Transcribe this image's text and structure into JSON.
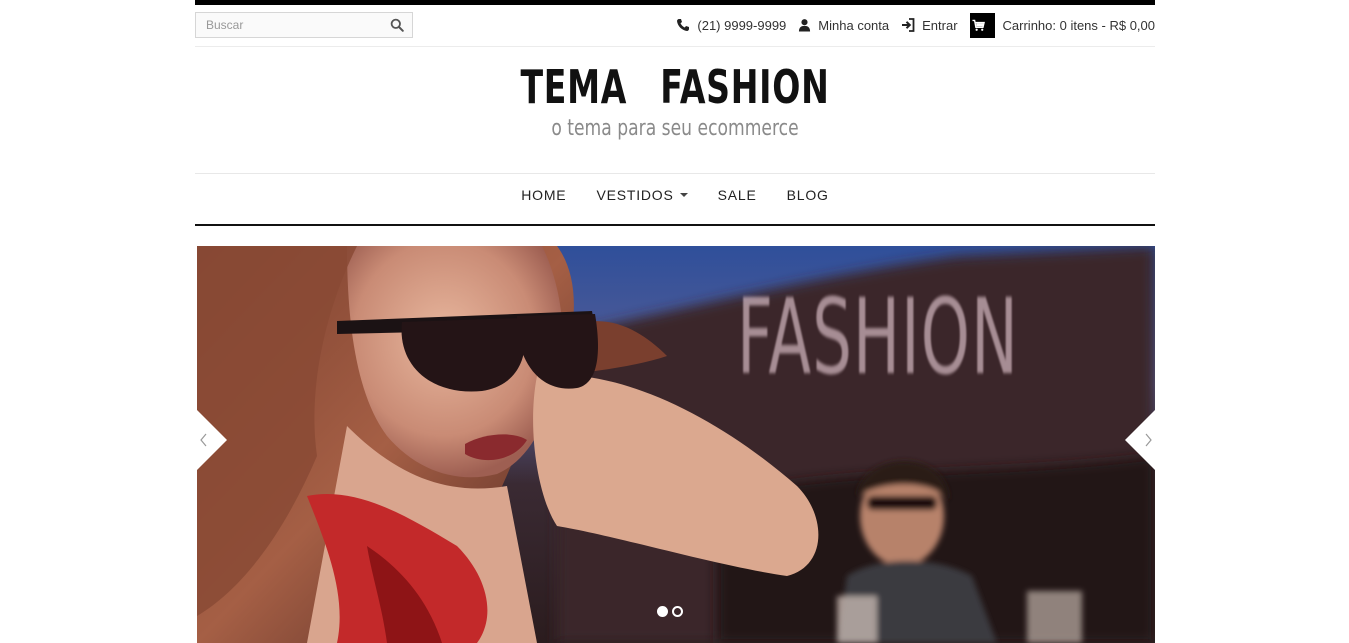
{
  "search": {
    "placeholder": "Buscar",
    "icon": "search-icon"
  },
  "top_links": {
    "phone": "(21) 9999-9999",
    "account": "Minha conta",
    "login": "Entrar",
    "cart": "Carrinho: 0 itens - R$ 0,00"
  },
  "logo": {
    "title": "TEMA  FASHION",
    "subtitle": "o tema para seu ecommerce"
  },
  "nav": {
    "items": [
      {
        "label": "HOME"
      },
      {
        "label": "VESTIDOS",
        "has_dropdown": true
      },
      {
        "label": "SALE"
      },
      {
        "label": "BLOG"
      }
    ]
  },
  "slider": {
    "overlay_text": "FASHION",
    "slide_count": 2,
    "active_slide": 1
  },
  "colors": {
    "accent": "#000000",
    "subtitle": "#8a8a8a",
    "border": "#e8e8e8"
  }
}
